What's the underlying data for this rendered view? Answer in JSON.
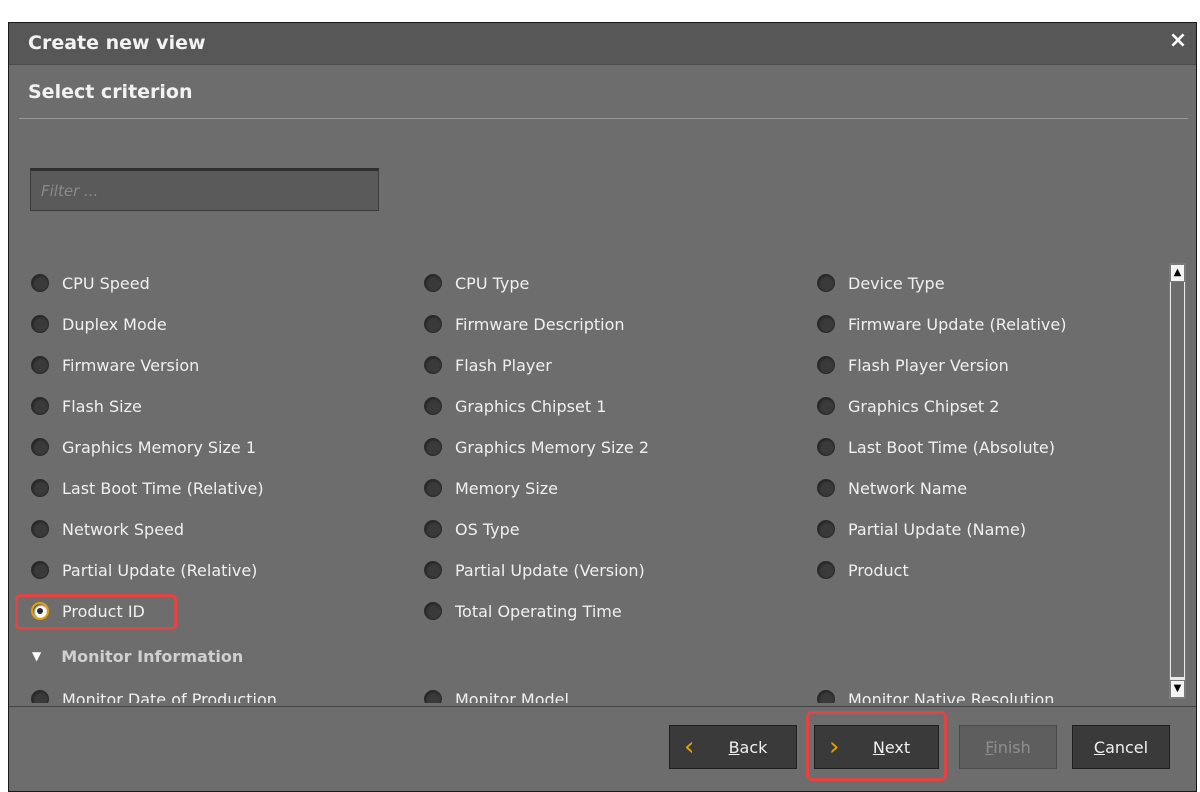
{
  "dialog": {
    "title": "Create new view",
    "close_label": "×",
    "subheading": "Select criterion"
  },
  "filter": {
    "placeholder": "Filter ...",
    "value": ""
  },
  "options": {
    "r1": [
      "CPU Speed",
      "CPU Type",
      "Device Type"
    ],
    "r2": [
      "Duplex Mode",
      "Firmware Description",
      "Firmware Update (Relative)"
    ],
    "r3": [
      "Firmware Version",
      "Flash Player",
      "Flash Player Version"
    ],
    "r4": [
      "Flash Size",
      "Graphics Chipset 1",
      "Graphics Chipset 2"
    ],
    "r5": [
      "Graphics Memory Size 1",
      "Graphics Memory Size 2",
      "Last Boot Time (Absolute)"
    ],
    "r6": [
      "Last Boot Time (Relative)",
      "Memory Size",
      "Network Name"
    ],
    "r7": [
      "Network Speed",
      "OS Type",
      "Partial Update (Name)"
    ],
    "r8": [
      "Partial Update (Relative)",
      "Partial Update (Version)",
      "Product"
    ],
    "r9": [
      "Product ID",
      "Total Operating Time"
    ],
    "selected": "Product ID"
  },
  "section": {
    "title": "Monitor Information"
  },
  "monitor_options": [
    "Monitor Date of Production",
    "Monitor Model",
    "Monitor Native Resolution"
  ],
  "buttons": {
    "back": {
      "u": "B",
      "rest": "ack"
    },
    "next": {
      "u": "N",
      "rest": "ext"
    },
    "finish": {
      "u": "F",
      "rest": "inish"
    },
    "cancel": {
      "u": "C",
      "rest": "ancel"
    }
  },
  "colors": {
    "accent": "#e2a100",
    "highlight": "#e24444",
    "dialog_bg": "#6d6d6d",
    "titlebar_bg": "#575757"
  }
}
